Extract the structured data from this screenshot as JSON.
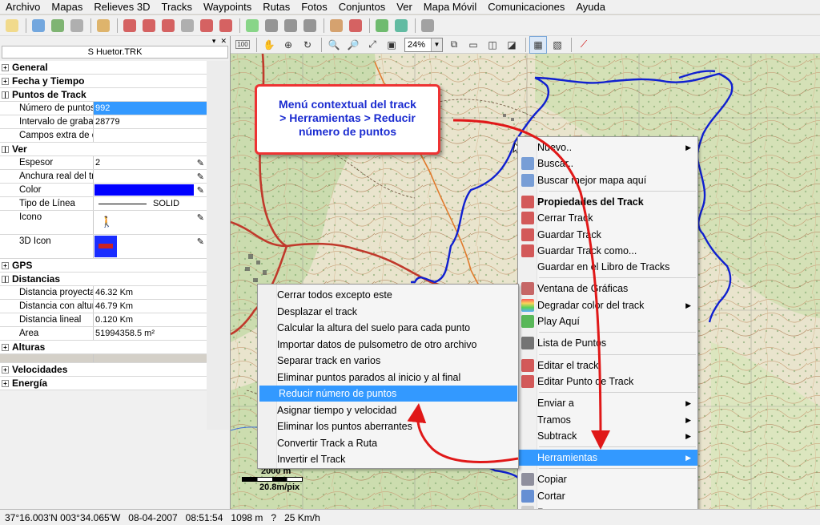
{
  "menubar": [
    "Archivo",
    "Mapas",
    "Relieves 3D",
    "Tracks",
    "Waypoints",
    "Rutas",
    "Fotos",
    "Conjuntos",
    "Ver",
    "Mapa Móvil",
    "Comunicaciones",
    "Ayuda"
  ],
  "toolbar2": {
    "zoom_value": "24%",
    "scale_100": "100"
  },
  "panel": {
    "title": "S Huetor.TRK",
    "rows": [
      {
        "k": "General",
        "cat": true
      },
      {
        "k": "Fecha y Tiempo",
        "cat": true
      },
      {
        "k": "Puntos de Track",
        "cat": true,
        "open": true
      },
      {
        "k": "Número de puntos",
        "v": "992",
        "sel": true
      },
      {
        "k": "Intervalo de grabación",
        "v": "28779"
      },
      {
        "k": "Campos extra de datos",
        "v": ""
      },
      {
        "k": "Ver",
        "cat": true,
        "open": true
      },
      {
        "k": "Espesor",
        "v": "2",
        "pencil": true
      },
      {
        "k": "Anchura real del track",
        "v": "",
        "pencil": true
      },
      {
        "k": "Color",
        "v": "",
        "color": "#0000ff",
        "pencil": true
      },
      {
        "k": "Tipo de Línea",
        "v": "SOLID",
        "line": true
      },
      {
        "k": "Icono",
        "v": "",
        "icon": true,
        "tall": true,
        "pencil": true
      },
      {
        "k": "3D Icon",
        "v": "",
        "icon3d": true,
        "tall": true,
        "pencil": true
      },
      {
        "k": "GPS",
        "cat": true
      },
      {
        "k": "Distancias",
        "cat": true,
        "open": true
      },
      {
        "k": "Distancia proyectada",
        "v": "46.32 Km"
      },
      {
        "k": "Distancia con altura",
        "v": "46.79 Km"
      },
      {
        "k": "Distancia lineal",
        "v": "0.120 Km"
      },
      {
        "k": "Area",
        "v": "51994358.5 m²"
      },
      {
        "k": "Alturas",
        "cat": true
      },
      {
        "k": "",
        "grey": true
      },
      {
        "k": "Velocidades",
        "cat": true
      },
      {
        "k": "Energía",
        "cat": true
      }
    ]
  },
  "callout": [
    "Menú contextual del track",
    "> Herramientas > Reducir",
    "número de puntos"
  ],
  "context_menu": [
    {
      "label": "Nuevo..",
      "arrow": true,
      "icon": "none"
    },
    {
      "label": "Buscar..",
      "icon": "search"
    },
    {
      "label": "Buscar mejor mapa aquí",
      "icon": "search"
    },
    {
      "sep": true
    },
    {
      "label": "Propiedades del Track",
      "bold": true,
      "icon": "track"
    },
    {
      "label": "Cerrar Track",
      "icon": "track"
    },
    {
      "label": "Guardar Track",
      "icon": "track"
    },
    {
      "label": "Guardar Track como...",
      "icon": "track"
    },
    {
      "label": "Guardar en el Libro de Tracks",
      "icon": "none"
    },
    {
      "sep": true
    },
    {
      "label": "Ventana de Gráficas",
      "icon": "graph"
    },
    {
      "label": "Degradar color del track",
      "arrow": true,
      "icon": "gradient"
    },
    {
      "label": "Play Aquí",
      "icon": "play"
    },
    {
      "sep": true
    },
    {
      "label": "Lista de Puntos",
      "icon": "list"
    },
    {
      "sep": true
    },
    {
      "label": "Editar el track",
      "icon": "track"
    },
    {
      "label": "Editar Punto de Track",
      "icon": "track"
    },
    {
      "sep": true
    },
    {
      "label": "Enviar a",
      "arrow": true,
      "icon": "none"
    },
    {
      "label": "Tramos",
      "arrow": true,
      "icon": "none"
    },
    {
      "label": "Subtrack",
      "arrow": true,
      "icon": "none"
    },
    {
      "sep": true
    },
    {
      "label": "Herramientas",
      "arrow": true,
      "hl": true,
      "icon": "none"
    },
    {
      "sep": true
    },
    {
      "label": "Copiar",
      "icon": "copy"
    },
    {
      "label": "Cortar",
      "icon": "cut"
    },
    {
      "label": "Pegar",
      "dis": true,
      "icon": "paste"
    }
  ],
  "sub_menu": [
    "Cerrar todos excepto este",
    "Desplazar el track",
    "Calcular la altura del suelo para cada punto",
    "Importar datos de pulsometro de otro archivo",
    "Separar track en varios",
    "Eliminar puntos parados al inicio y al final",
    "Reducir número de puntos",
    "Asignar tiempo y velocidad",
    "Eliminar los puntos aberrantes",
    "Convertir Track a Ruta",
    "Invertir el Track"
  ],
  "sub_menu_highlight": "Reducir número de puntos",
  "scale": {
    "distance": "2000 m",
    "resolution": "20.8m/pix"
  },
  "status": [
    "37°16.003'N 003°34.065'W",
    "08-04-2007",
    "08:51:54",
    "1098 m",
    "?",
    "25 Km/h"
  ],
  "colors": {
    "accent": "#3399ff",
    "track": "#1020d0",
    "callout_border": "#ee3333",
    "callout_text": "#1a2bd0"
  }
}
